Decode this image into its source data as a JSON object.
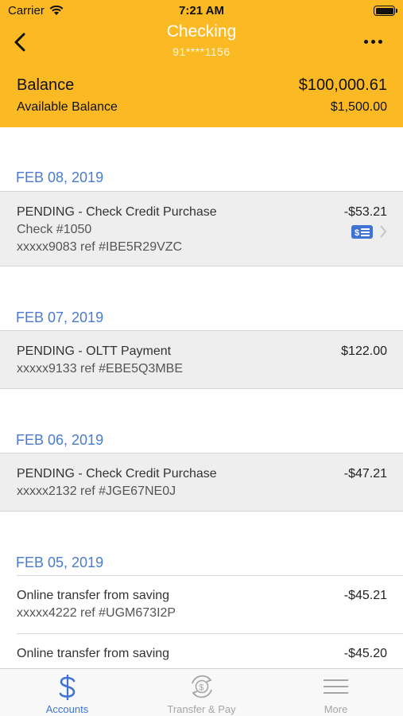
{
  "status_bar": {
    "carrier": "Carrier",
    "time": "7:21 AM"
  },
  "nav": {
    "title": "Checking",
    "account_number": "91****1156"
  },
  "balance": {
    "balance_label": "Balance",
    "balance_value": "$100,000.61",
    "available_label": "Available Balance",
    "available_value": "$1,500.00"
  },
  "groups": [
    {
      "date": "FEB 08, 2019",
      "transactions": [
        {
          "title": "PENDING - Check Credit Purchase",
          "check": "Check #1050",
          "ref": "xxxxx9083 ref #IBE5R29VZC",
          "amount": "-$53.21"
        }
      ]
    },
    {
      "date": "FEB 07, 2019",
      "transactions": [
        {
          "title": "PENDING - OLTT Payment",
          "ref": "xxxxx9133 ref #EBE5Q3MBE",
          "amount": "$122.00"
        }
      ]
    },
    {
      "date": "FEB 06, 2019",
      "transactions": [
        {
          "title": "PENDING - Check Credit Purchase",
          "ref": "xxxxx2132 ref #JGE67NE0J",
          "amount": "-$47.21"
        }
      ]
    },
    {
      "date": "FEB 05, 2019",
      "transactions": [
        {
          "title": "Online transfer from saving",
          "ref": "xxxxx4222 ref #UGM673I2P",
          "amount": "-$45.21"
        },
        {
          "title": "Online transfer from saving",
          "amount": "-$45.20"
        }
      ]
    }
  ],
  "tabs": [
    {
      "label": "Accounts",
      "icon": "dollar-icon",
      "active": true
    },
    {
      "label": "Transfer & Pay",
      "icon": "transfer-dollar-icon",
      "active": false
    },
    {
      "label": "More",
      "icon": "hamburger-icon",
      "active": false
    }
  ],
  "colors": {
    "header": "#fbb924",
    "accent": "#3f74d6",
    "date": "#4a7bd0"
  }
}
